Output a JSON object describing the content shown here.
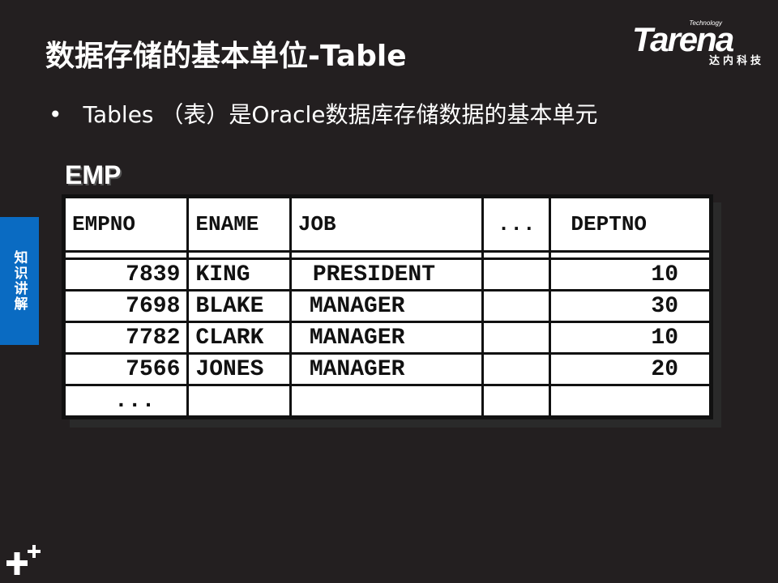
{
  "title": "数据存储的基本单位-Table",
  "logo": {
    "technology": "Technology",
    "brand": "Tarena",
    "cn": "达内科技"
  },
  "bullet": {
    "dot": "•",
    "text": "Tables （表）是Oracle数据库存储数据的基本单元"
  },
  "side_tab": {
    "label": "知识讲解"
  },
  "table": {
    "name": "EMP",
    "headers": [
      "EMPNO",
      "ENAME",
      "JOB",
      "...",
      "DEPTNO"
    ],
    "rows": [
      [
        "7839",
        "KING",
        "PRESIDENT",
        "",
        "10"
      ],
      [
        "7698",
        "BLAKE",
        "MANAGER",
        "",
        "30"
      ],
      [
        "7782",
        "CLARK",
        "MANAGER",
        "",
        "10"
      ],
      [
        "7566",
        "JONES",
        "MANAGER",
        "",
        "20"
      ],
      [
        "...",
        "",
        "",
        "",
        ""
      ]
    ]
  },
  "colors": {
    "background": "#231f20",
    "side_tab": "#0a6bc2"
  },
  "icons": {
    "footer": "plus-icon"
  }
}
